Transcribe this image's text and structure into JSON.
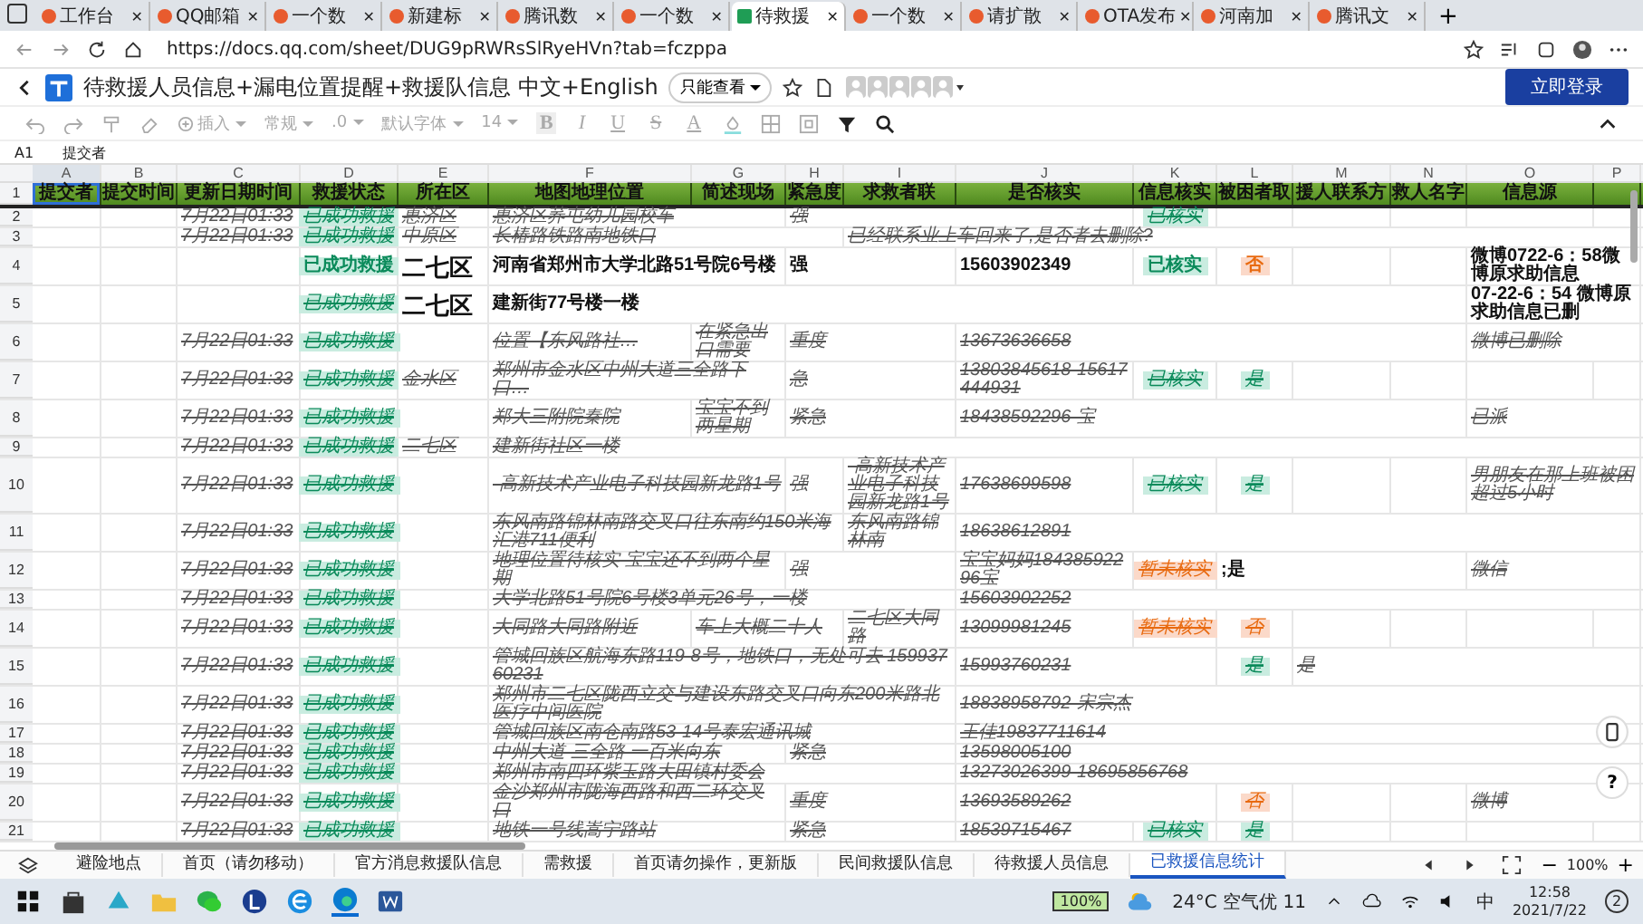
{
  "browser": {
    "tabs": [
      {
        "label": "工作台",
        "selected": false
      },
      {
        "label": "QQ邮箱",
        "selected": false
      },
      {
        "label": "一个数",
        "selected": false
      },
      {
        "label": "新建标",
        "selected": false
      },
      {
        "label": "腾讯数",
        "selected": false
      },
      {
        "label": "一个数",
        "selected": false
      },
      {
        "label": "待救援",
        "selected": true
      },
      {
        "label": "一个数",
        "selected": false
      },
      {
        "label": "请扩散",
        "selected": false
      },
      {
        "label": "OTA发布",
        "selected": false
      },
      {
        "label": "河南加",
        "selected": false
      },
      {
        "label": "腾讯文",
        "selected": false
      }
    ],
    "close": "✕",
    "new_tab": "+",
    "url": "https://docs.qq.com/sheet/DUG9pRWRsSlRyeHVn?tab=fczppa"
  },
  "doc": {
    "title": "待救援人员信息+漏电位置提醒+救援队信息 中文+English",
    "mode": "只能查看",
    "login": "立即登录"
  },
  "toolbar": {
    "insert": "插入",
    "format": "常规",
    "decimal": ".0",
    "font": "默认字体",
    "size": "14",
    "bold": "B",
    "italic": "I",
    "underline": "U",
    "strike": "S",
    "text_color_label": "A"
  },
  "formula_bar": {
    "cell": "A1",
    "value": "提交者"
  },
  "columns": [
    {
      "letter": "A",
      "header": "提交者"
    },
    {
      "letter": "B",
      "header": "提交时间"
    },
    {
      "letter": "C",
      "header": "更新日期时间"
    },
    {
      "letter": "D",
      "header": "救援状态"
    },
    {
      "letter": "E",
      "header": "所在区"
    },
    {
      "letter": "F",
      "header": "地图地理位置"
    },
    {
      "letter": "G",
      "header": "简述现场"
    },
    {
      "letter": "H",
      "header": "紧急度"
    },
    {
      "letter": "I",
      "header": "求救者联"
    },
    {
      "letter": "J",
      "header": "是否核实"
    },
    {
      "letter": "K",
      "header": "信息核实"
    },
    {
      "letter": "L",
      "header": "被困者取"
    },
    {
      "letter": "M",
      "header": "援人联系方"
    },
    {
      "letter": "N",
      "header": "救人名字"
    },
    {
      "letter": "O",
      "header": "信息源"
    },
    {
      "letter": "P"
    }
  ],
  "header_row": "1",
  "rows": [
    {
      "num": "2",
      "cells": {
        "C": {
          "text": "7月22日01:33",
          "kind": "text",
          "struck": true
        },
        "D": {
          "text": "已成功救援",
          "kind": "badge-green",
          "struck": true
        },
        "E": {
          "text": "惠济区",
          "kind": "text",
          "struck": true
        },
        "F": {
          "text": "惠济区荞屯幼儿园校车",
          "kind": "text",
          "struck": true
        },
        "H": {
          "text": "强",
          "kind": "text",
          "struck": true
        },
        "K": {
          "text": "已核实",
          "kind": "badge-green",
          "struck": true
        }
      }
    },
    {
      "num": "3",
      "cells": {
        "C": {
          "text": "7月22日01:33",
          "kind": "text",
          "struck": true
        },
        "D": {
          "text": "已成功救援",
          "kind": "badge-green",
          "struck": true
        },
        "E": {
          "text": "中原区",
          "kind": "text",
          "struck": true
        },
        "F": {
          "text": "长椿路铁路南地铁口",
          "kind": "text",
          "struck": true
        },
        "I": {
          "text": "已经联系业上车回来了,是否者去删除?",
          "kind": "text",
          "struck": true
        }
      }
    },
    {
      "num": "4",
      "cells": {
        "D": {
          "text": "已成功救援",
          "kind": "badge-green",
          "struck": false
        },
        "E": {
          "text": "二七区",
          "kind": "large-text",
          "struck": false
        },
        "F": {
          "text": "河南省郑州市大学北路51号院6号楼",
          "kind": "text",
          "struck": false
        },
        "H": {
          "text": "强",
          "kind": "text",
          "struck": false
        },
        "J": {
          "text": "15603902349",
          "kind": "text",
          "struck": false
        },
        "K": {
          "text": "已核实",
          "kind": "badge-green",
          "struck": false
        },
        "L": {
          "text": "否",
          "kind": "badge-orange",
          "struck": false
        },
        "O": {
          "text": "微博0722-6：58微博原求助信息",
          "kind": "text",
          "struck": false
        }
      }
    },
    {
      "num": "5",
      "cells": {
        "D": {
          "text": "已成功救援",
          "kind": "badge-green",
          "struck": true
        },
        "E": {
          "text": "二七区",
          "kind": "large-text",
          "struck": false
        },
        "F": {
          "text": "建新街77号楼一楼",
          "kind": "text",
          "struck": false
        },
        "O": {
          "text": "07-22-6：54 微博原求助信息已删",
          "kind": "text",
          "struck": false
        }
      }
    },
    {
      "num": "6",
      "cells": {
        "C": {
          "text": "7月22日01:33",
          "kind": "text",
          "struck": true
        },
        "D": {
          "text": "已成功救援",
          "kind": "badge-green",
          "struck": true
        },
        "F": {
          "text": "位置【东风路社…",
          "kind": "text",
          "struck": true
        },
        "G": {
          "text": "在紧急出口需要",
          "kind": "text",
          "struck": true
        },
        "H": {
          "text": "重度",
          "kind": "text",
          "struck": true
        },
        "J": {
          "text": "13673636658",
          "kind": "text",
          "struck": true
        },
        "O": {
          "text": "微博已删除",
          "kind": "text",
          "struck": true
        }
      }
    },
    {
      "num": "7",
      "cells": {
        "C": {
          "text": "7月22日01:33",
          "kind": "text",
          "struck": true
        },
        "D": {
          "text": "已成功救援",
          "kind": "badge-green",
          "struck": true
        },
        "E": {
          "text": "金水区",
          "kind": "text",
          "struck": true
        },
        "F": {
          "text": "郑州市金水区中州大道三全路下口…",
          "kind": "text",
          "struck": true
        },
        "H": {
          "text": "急",
          "kind": "text",
          "struck": true
        },
        "J": {
          "text": "13803845618-15617444931",
          "kind": "text",
          "struck": true
        },
        "K": {
          "text": "已核实",
          "kind": "badge-green",
          "struck": true
        },
        "L": {
          "text": "是",
          "kind": "badge-green",
          "struck": true
        }
      }
    },
    {
      "num": "8",
      "cells": {
        "C": {
          "text": "7月22日01:33",
          "kind": "text",
          "struck": true
        },
        "D": {
          "text": "已成功救援",
          "kind": "badge-green",
          "struck": true
        },
        "F": {
          "text": "郑大三附院秦院",
          "kind": "text",
          "struck": true
        },
        "G": {
          "text": "宝宝不到两星期",
          "kind": "text",
          "struck": true
        },
        "H": {
          "text": "紧急",
          "kind": "text",
          "struck": true
        },
        "J": {
          "text": "18438592296-宝",
          "kind": "text",
          "struck": true
        },
        "O": {
          "text": "已派",
          "kind": "text",
          "struck": true
        }
      }
    },
    {
      "num": "9",
      "cells": {
        "C": {
          "text": "7月22日01:33",
          "kind": "text",
          "struck": true
        },
        "D": {
          "text": "已成功救援",
          "kind": "badge-green",
          "struck": true
        },
        "E": {
          "text": "二七区",
          "kind": "text",
          "struck": true
        },
        "F": {
          "text": "建新街社区一楼",
          "kind": "text",
          "struck": true
        }
      }
    },
    {
      "num": "10",
      "cells": {
        "C": {
          "text": "7月22日01:33",
          "kind": "text",
          "struck": true
        },
        "D": {
          "text": "已成功救援",
          "kind": "badge-green",
          "struck": true
        },
        "F": {
          "text": "-高新技术产业电子科技园新龙路1号",
          "kind": "text",
          "struck": true
        },
        "H": {
          "text": "强",
          "kind": "text",
          "struck": true
        },
        "I": {
          "text": "-高新技术产业电子科技园新龙路1号",
          "kind": "text",
          "struck": true
        },
        "J": {
          "text": "17638699598",
          "kind": "text",
          "struck": true
        },
        "K": {
          "text": "已核实",
          "kind": "badge-green",
          "struck": true
        },
        "L": {
          "text": "是",
          "kind": "badge-green",
          "struck": true
        },
        "O": {
          "text": "男朋友在那上班被困超过5小时",
          "kind": "text",
          "struck": true
        }
      }
    },
    {
      "num": "11",
      "cells": {
        "C": {
          "text": "7月22日01:33",
          "kind": "text",
          "struck": true
        },
        "D": {
          "text": "已成功救援",
          "kind": "badge-green",
          "struck": true
        },
        "F": {
          "text": "东风南路锦林南路交叉口往东南约150米海汇港711便利",
          "kind": "text",
          "struck": true
        },
        "I": {
          "text": "东风南路锦林南",
          "kind": "text",
          "struck": true
        },
        "J": {
          "text": "18638612891",
          "kind": "text",
          "struck": true
        }
      }
    },
    {
      "num": "12",
      "cells": {
        "C": {
          "text": "7月22日01:33",
          "kind": "text",
          "struck": true
        },
        "D": {
          "text": "已成功救援",
          "kind": "badge-green",
          "struck": true
        },
        "F": {
          "text": "地理位置待核实 宝宝还不到两个星期",
          "kind": "text",
          "struck": true
        },
        "H": {
          "text": "强",
          "kind": "text",
          "struck": true
        },
        "J": {
          "text": "宝宝妈妈18438592296宝",
          "kind": "text",
          "struck": true
        },
        "K": {
          "text": "暂未核实",
          "kind": "badge-orange",
          "struck": true
        },
        "L": {
          "text": ";是",
          "kind": "text",
          "struck": false
        },
        "O": {
          "text": "微信",
          "kind": "text",
          "struck": true
        }
      }
    },
    {
      "num": "13",
      "cells": {
        "C": {
          "text": "7月22日01:33",
          "kind": "text",
          "struck": true
        },
        "D": {
          "text": "已成功救援",
          "kind": "badge-green",
          "struck": true
        },
        "F": {
          "text": "大学北路51号院6号楼3单元26号，一楼",
          "kind": "text",
          "struck": true
        },
        "J": {
          "text": "15603902252",
          "kind": "text",
          "struck": true
        }
      }
    },
    {
      "num": "14",
      "cells": {
        "C": {
          "text": "7月22日01:33",
          "kind": "text",
          "struck": true
        },
        "D": {
          "text": "已成功救援",
          "kind": "badge-green",
          "struck": true
        },
        "F": {
          "text": "大同路大同路附近",
          "kind": "text",
          "struck": true
        },
        "G": {
          "text": "车上大概二十人",
          "kind": "text",
          "struck": true
        },
        "I": {
          "text": "二七区大同路",
          "kind": "text",
          "struck": true
        },
        "J": {
          "text": "13099981245",
          "kind": "text",
          "struck": true
        },
        "K": {
          "text": "暂未核实",
          "kind": "badge-orange",
          "struck": true
        },
        "L": {
          "text": "否",
          "kind": "badge-orange",
          "struck": true
        }
      }
    },
    {
      "num": "15",
      "cells": {
        "C": {
          "text": "7月22日01:33",
          "kind": "text",
          "struck": true
        },
        "D": {
          "text": "已成功救援",
          "kind": "badge-green",
          "struck": true
        },
        "F": {
          "text": "管城回族区航海东路119-8号，地铁口，无处可去 15993760231",
          "kind": "text",
          "struck": true
        },
        "J": {
          "text": "15993760231",
          "kind": "text",
          "struck": true
        },
        "L": {
          "text": "是",
          "kind": "badge-green",
          "struck": true
        },
        "M": {
          "text": "是",
          "kind": "text",
          "struck": true
        }
      }
    },
    {
      "num": "16",
      "cells": {
        "C": {
          "text": "7月22日01:33",
          "kind": "text",
          "struck": true
        },
        "D": {
          "text": "已成功救援",
          "kind": "badge-green",
          "struck": true
        },
        "F": {
          "text": "郑州市二七区陇西立交与建设东路交叉口向东200米路北医疗中间医院",
          "kind": "text",
          "struck": true
        },
        "J": {
          "text": "18838958792-宋宗杰",
          "kind": "text",
          "struck": true
        }
      }
    },
    {
      "num": "17",
      "cells": {
        "C": {
          "text": "7月22日01:33",
          "kind": "text",
          "struck": true
        },
        "D": {
          "text": "已成功救援",
          "kind": "badge-green",
          "struck": true
        },
        "F": {
          "text": "管城回族区南仓南路53-14号泰宏通讯城",
          "kind": "text",
          "struck": true
        },
        "J": {
          "text": "王佳19837711614",
          "kind": "text",
          "struck": true
        }
      }
    },
    {
      "num": "18",
      "cells": {
        "C": {
          "text": "7月22日01:33",
          "kind": "text",
          "struck": true
        },
        "D": {
          "text": "已成功救援",
          "kind": "badge-green",
          "struck": true
        },
        "F": {
          "text": "中州大道 三全路 一百米向东",
          "kind": "text",
          "struck": true
        },
        "H": {
          "text": "紧急",
          "kind": "text",
          "struck": true
        },
        "J": {
          "text": "13598005100",
          "kind": "text",
          "struck": true
        }
      }
    },
    {
      "num": "19",
      "cells": {
        "C": {
          "text": "7月22日01:33",
          "kind": "text",
          "struck": true
        },
        "D": {
          "text": "已成功救援",
          "kind": "badge-green",
          "struck": true
        },
        "F": {
          "text": "郑州市南四环紫玉路大田镇村委会",
          "kind": "text",
          "struck": true
        },
        "J": {
          "text": "13273026399-18695856768",
          "kind": "text",
          "struck": true
        }
      }
    },
    {
      "num": "20",
      "cells": {
        "C": {
          "text": "7月22日01:33",
          "kind": "text",
          "struck": true
        },
        "D": {
          "text": "已成功救援",
          "kind": "badge-green",
          "struck": true
        },
        "F": {
          "text": "金沙郑州市陇海西路和西二环交叉口",
          "kind": "text",
          "struck": true
        },
        "H": {
          "text": "重度",
          "kind": "text",
          "struck": true
        },
        "J": {
          "text": "13693589262",
          "kind": "text",
          "struck": true
        },
        "L": {
          "text": "否",
          "kind": "badge-orange",
          "struck": true
        },
        "O": {
          "text": "微博",
          "kind": "text",
          "struck": true
        }
      }
    },
    {
      "num": "21",
      "cells": {
        "C": {
          "text": "7月22日01:33",
          "kind": "text",
          "struck": true
        },
        "D": {
          "text": "已成功救援",
          "kind": "badge-green",
          "struck": true
        },
        "F": {
          "text": "地铁一号线嵩宁路站",
          "kind": "text",
          "struck": true
        },
        "H": {
          "text": "紧急",
          "kind": "text",
          "struck": true
        },
        "J": {
          "text": "18539715467",
          "kind": "text",
          "struck": true
        },
        "K": {
          "text": "已核实",
          "kind": "badge-green",
          "struck": true
        },
        "L": {
          "text": "是",
          "kind": "badge-green",
          "struck": true
        }
      }
    }
  ],
  "side_buttons": {
    "help": "?"
  },
  "sheet_tabs": [
    {
      "label": "避险地点",
      "selected": false
    },
    {
      "label": "首页（请勿移动）",
      "selected": false
    },
    {
      "label": "官方消息救援队信息",
      "selected": false
    },
    {
      "label": "需救援",
      "selected": false
    },
    {
      "label": "首页请勿操作，更新版",
      "selected": false
    },
    {
      "label": "民间救援队信息",
      "selected": false
    },
    {
      "label": "待救援人员信息",
      "selected": false
    },
    {
      "label": "已救援信息统计",
      "selected": true
    }
  ],
  "zoom": "100%",
  "zoom_out": "−",
  "zoom_in": "+",
  "taskbar": {
    "battery": "100%",
    "weather": "24°C 空气优 11",
    "ime": "中",
    "time": "12:58",
    "date": "2021/7/22",
    "notifications": "2"
  }
}
